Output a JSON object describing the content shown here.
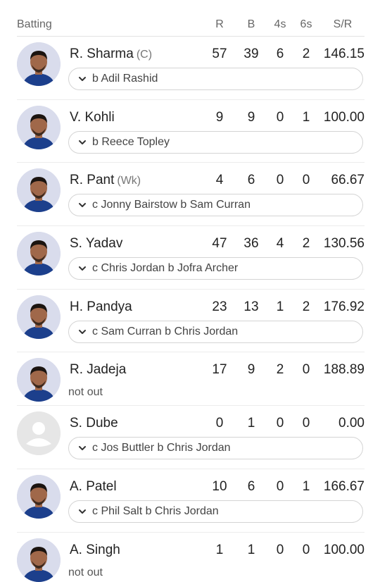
{
  "header": {
    "batting": "Batting",
    "r": "R",
    "b": "B",
    "fours": "4s",
    "sixes": "6s",
    "sr": "S/R"
  },
  "batters": [
    {
      "name": "R. Sharma",
      "tag": "(C)",
      "r": "57",
      "b": "39",
      "fours": "6",
      "sixes": "2",
      "sr": "146.15",
      "dismissal": "b Adil Rashid",
      "avatar": "player-photo"
    },
    {
      "name": "V. Kohli",
      "tag": "",
      "r": "9",
      "b": "9",
      "fours": "0",
      "sixes": "1",
      "sr": "100.00",
      "dismissal": "b Reece Topley",
      "avatar": "player-photo"
    },
    {
      "name": "R. Pant",
      "tag": "(Wk)",
      "r": "4",
      "b": "6",
      "fours": "0",
      "sixes": "0",
      "sr": "66.67",
      "dismissal": "c Jonny Bairstow b Sam Curran",
      "avatar": "player-photo"
    },
    {
      "name": "S. Yadav",
      "tag": "",
      "r": "47",
      "b": "36",
      "fours": "4",
      "sixes": "2",
      "sr": "130.56",
      "dismissal": "c Chris Jordan b Jofra Archer",
      "avatar": "player-photo"
    },
    {
      "name": "H. Pandya",
      "tag": "",
      "r": "23",
      "b": "13",
      "fours": "1",
      "sixes": "2",
      "sr": "176.92",
      "dismissal": "c Sam Curran b Chris Jordan",
      "avatar": "player-photo"
    },
    {
      "name": "R. Jadeja",
      "tag": "",
      "r": "17",
      "b": "9",
      "fours": "2",
      "sixes": "0",
      "sr": "188.89",
      "status": "not out",
      "avatar": "player-photo"
    },
    {
      "name": "S. Dube",
      "tag": "",
      "r": "0",
      "b": "1",
      "fours": "0",
      "sixes": "0",
      "sr": "0.00",
      "dismissal": "c Jos Buttler b Chris Jordan",
      "avatar": "placeholder"
    },
    {
      "name": "A. Patel",
      "tag": "",
      "r": "10",
      "b": "6",
      "fours": "0",
      "sixes": "1",
      "sr": "166.67",
      "dismissal": "c Phil Salt b Chris Jordan",
      "avatar": "player-photo"
    },
    {
      "name": "A. Singh",
      "tag": "",
      "r": "1",
      "b": "1",
      "fours": "0",
      "sixes": "0",
      "sr": "100.00",
      "status": "not out",
      "avatar": "player-photo"
    }
  ],
  "colors": {
    "avatar_bg": "#d9dcec",
    "placeholder_bg": "#e6e6e6",
    "jersey": "#1c3f8c",
    "skin": "#a0684a",
    "hair": "#1b1410"
  }
}
